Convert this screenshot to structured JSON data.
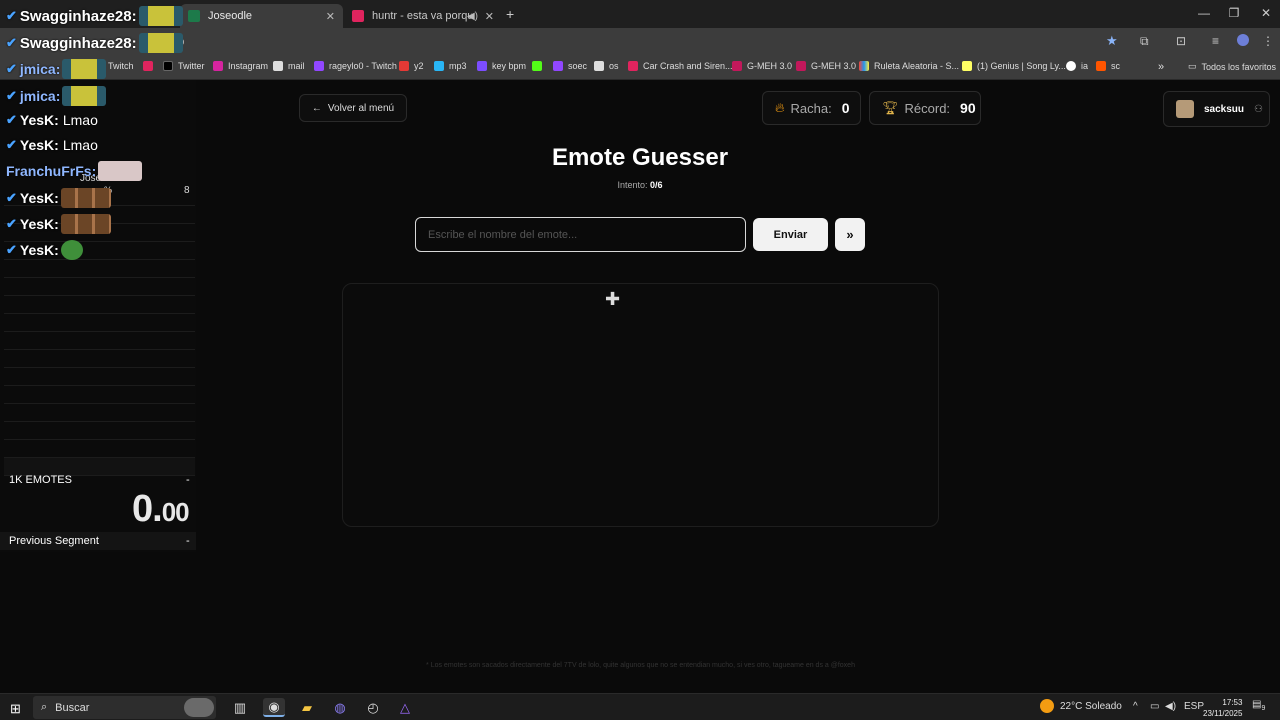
{
  "browser": {
    "tabs": [
      {
        "label": "Joseodle",
        "active": true
      },
      {
        "label": "huntr - esta va porque te q",
        "active": false
      }
    ],
    "new_tab": "+",
    "url_fragment": "pp",
    "bookmarks": [
      "Twitch",
      "Twitter",
      "Instagram",
      "mail",
      "rageylo0 - Twitch",
      "y2",
      "mp3",
      "key bpm",
      "soec",
      "os",
      "Car Crash and Siren...",
      "G-MEH 3.0",
      "G-MEH 3.0",
      "Ruleta Aleatoria - S...",
      "(1) Genius | Song Ly...",
      "ia",
      "sc"
    ],
    "all_favorites": "Todos los favoritos",
    "more": "»"
  },
  "overlay": {
    "chat": [
      {
        "nick": "Swagginhaze28:",
        "msg": "",
        "emote": "glasses",
        "style": "big"
      },
      {
        "nick": "Swagginhaze28:",
        "msg": "",
        "emote": "glasses",
        "style": "big"
      },
      {
        "nick": "jmica:",
        "msg": "",
        "emote": "glasses",
        "style": "blue"
      },
      {
        "nick": "jmica:",
        "msg": "",
        "emote": "glasses",
        "style": "blue"
      },
      {
        "nick": "YesK:",
        "msg": "Lmao",
        "emote": "",
        "style": "normal"
      },
      {
        "nick": "YesK:",
        "msg": "Lmao",
        "emote": "",
        "style": "normal"
      },
      {
        "nick": "FranchuFrFs:",
        "msg": "",
        "emote": "pale",
        "style": "blue"
      },
      {
        "nick": "YesK:",
        "msg": "",
        "emote": "monkeys",
        "style": "normal"
      },
      {
        "nick": "YesK:",
        "msg": "",
        "emote": "monkeys",
        "style": "normal"
      },
      {
        "nick": "YesK:",
        "msg": "",
        "emote": "frog",
        "style": "normal"
      }
    ],
    "split_title": "Joseodle",
    "split_pct": "%",
    "split_count": "8",
    "segment_name": "1K EMOTES",
    "segment_delta": "-",
    "timer_main": "0.",
    "timer_fraction": "00",
    "previous_segment_label": "Previous Segment",
    "previous_segment_value": "-"
  },
  "app": {
    "back_label": "Volver al menú",
    "streak_label": "Racha:",
    "streak_value": "0",
    "record_label": "Récord:",
    "record_value": "90",
    "username": "sacksuu",
    "title": "Emote Guesser",
    "attempt_label": "Intento:",
    "attempt_value": "0/6",
    "input_placeholder": "Escribe el nombre del emote...",
    "send_label": "Enviar",
    "skip_label": "»",
    "footnote": "* Los emotes son sacados directamente del 7TV de lolo, quite algunos que no se entendian mucho, si ves otro, tagueame en ds a @foxeh"
  },
  "taskbar": {
    "search_label": "Buscar",
    "weather": "22°C  Soleado",
    "lang": "ESP",
    "time": "17:53",
    "date": "23/11/2025",
    "notif_count": "9"
  },
  "colors": {
    "accent_check": "#4aa3ff",
    "flame": "#f39c12",
    "trophy": "#e0b34a",
    "star": "#8ab4f8"
  }
}
